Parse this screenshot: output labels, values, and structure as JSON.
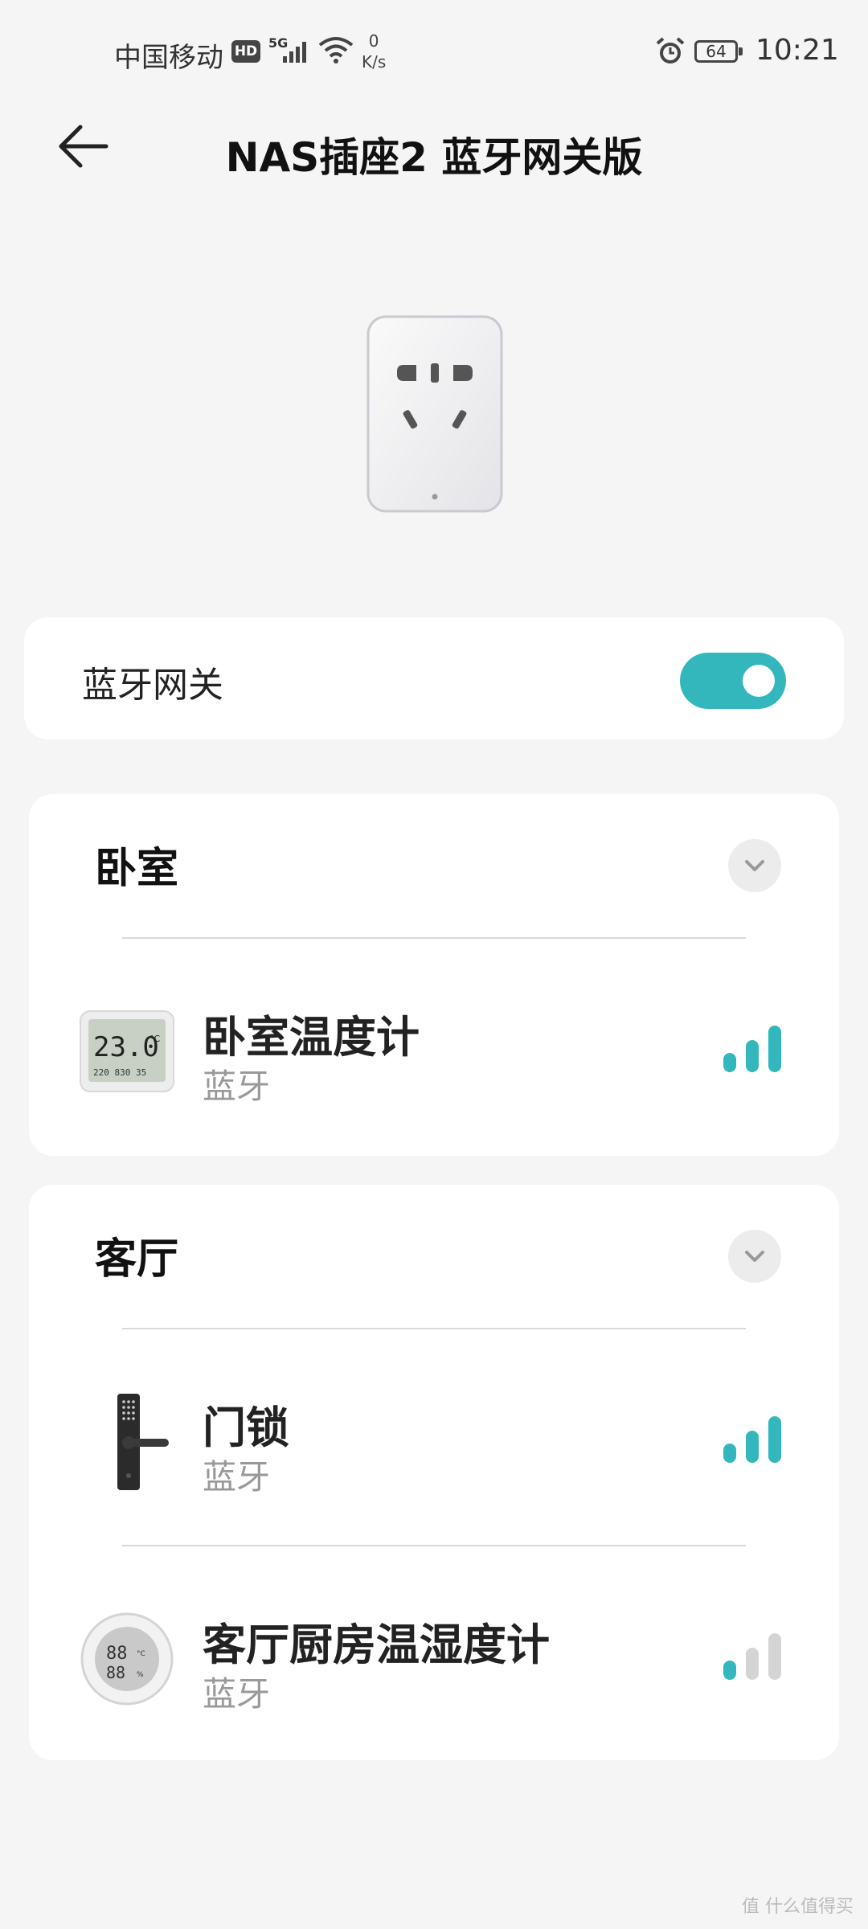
{
  "status_bar": {
    "carrier": "中国移动",
    "hd": "HD",
    "network": "5G",
    "speed_value": "0",
    "speed_unit": "K/s",
    "battery": "64",
    "time": "10:21"
  },
  "header": {
    "title": "NAS插座2 蓝牙网关版"
  },
  "gateway": {
    "label": "蓝牙网关",
    "enabled": true
  },
  "rooms": [
    {
      "name": "卧室",
      "devices": [
        {
          "name": "卧室温度计",
          "type": "蓝牙",
          "icon": "thermometer-lcd-icon",
          "signal_bars": 3
        }
      ]
    },
    {
      "name": "客厅",
      "devices": [
        {
          "name": "门锁",
          "type": "蓝牙",
          "icon": "door-lock-icon",
          "signal_bars": 3
        },
        {
          "name": "客厅厨房温湿度计",
          "type": "蓝牙",
          "icon": "round-hygrometer-icon",
          "signal_bars": 1
        }
      ]
    }
  ],
  "colors": {
    "accent": "#33b7bd",
    "signal_inactive": "#d4d4d4"
  },
  "thermo_display": {
    "main": "23.0",
    "unit": "°C",
    "row": "220 830 35"
  },
  "watermark": "值 什么值得买"
}
